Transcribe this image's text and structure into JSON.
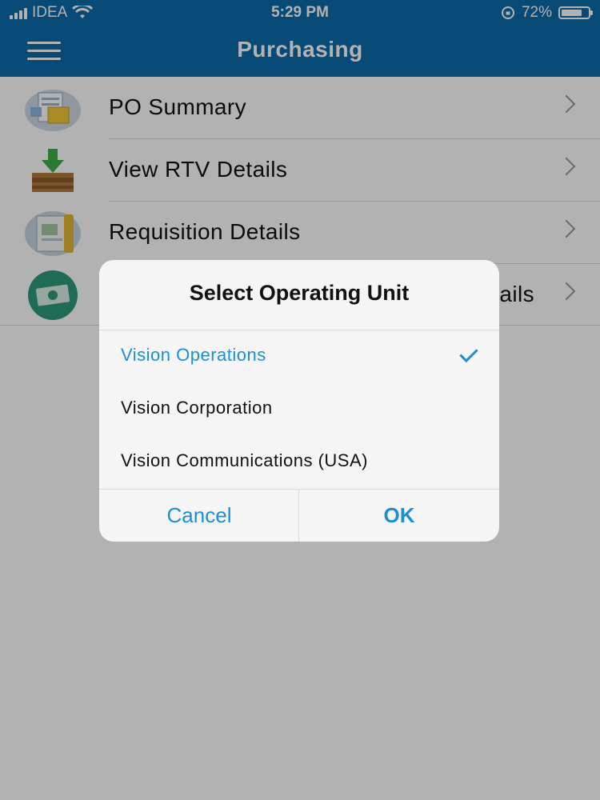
{
  "status_bar": {
    "carrier": "IDEA",
    "time": "5:29 PM",
    "battery": "72%"
  },
  "nav": {
    "title": "Purchasing",
    "menu_icon": "hamburger-menu-icon"
  },
  "menu_items": [
    {
      "label": "PO Summary",
      "icon": "po-summary-icon"
    },
    {
      "label": "View RTV Details",
      "icon": "rtv-inbox-icon"
    },
    {
      "label": "Requisition Details",
      "icon": "requisition-document-icon"
    },
    {
      "label": "tails",
      "icon": "payment-money-icon"
    }
  ],
  "dialog": {
    "title": "Select Operating Unit",
    "options": [
      {
        "label": "Vision Operations",
        "selected": true
      },
      {
        "label": "Vision Corporation",
        "selected": false
      },
      {
        "label": "Vision Communications (USA)",
        "selected": false
      }
    ],
    "cancel_label": "Cancel",
    "ok_label": "OK"
  },
  "colors": {
    "brand_blue": "#0b6aa8",
    "accent_blue": "#1d8fd0"
  }
}
